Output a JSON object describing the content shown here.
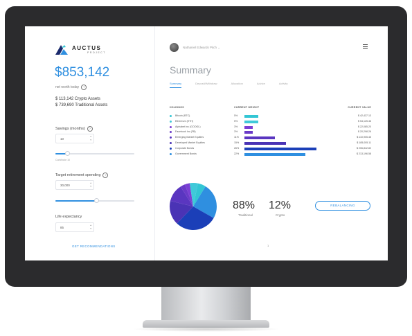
{
  "sidebar": {
    "logo_text": "AUCTUS",
    "logo_sub": "PROJECT",
    "net_worth": "$853,142",
    "net_worth_label": "net worth today",
    "crypto_assets": "$ 113,142 Crypto Assets",
    "traditional_assets": "$ 739,690 Traditional Assets",
    "savings_label": "Savings (months)",
    "savings_value": "10",
    "savings_hint": "Contribute 10",
    "savings_slider": 0.15,
    "target_label": "Target retirement spending",
    "target_value": "30,000",
    "target_slider": 0.52,
    "life_label": "Life expectancy",
    "life_value": "85",
    "get_recommendations": "GET RECOMMENDATIONS"
  },
  "main": {
    "user_name": "Nathaniel Edwards Pitch",
    "title": "Summary",
    "tabs": [
      "Summary",
      "Deposit/Withdraw",
      "Allocation",
      "Advice",
      "Activity"
    ],
    "active_tab": 0,
    "table_headers": {
      "holdings": "HOLDINGS",
      "weight": "CURRENT WEIGHT",
      "value": "CURRENT VALUE"
    },
    "rows": [
      {
        "name": "Bitcoin (BTC)",
        "pct": "5%",
        "weight": 5,
        "color": "#33c6d4",
        "value": "$ 42,437.13"
      },
      {
        "name": "Ethereum (ETH)",
        "pct": "5%",
        "weight": 5,
        "color": "#40c9d9",
        "value": "$ 54,125.46"
      },
      {
        "name": "Alphabet Inc (GOOGL)",
        "pct": "3%",
        "weight": 3,
        "color": "#7b3fd4",
        "value": "$ 22,085.20"
      },
      {
        "name": "Facebook Inc (FB)",
        "pct": "3%",
        "weight": 3,
        "color": "#6a3ac8",
        "value": "$ 20,298.26"
      },
      {
        "name": "Emerging Market Equities",
        "pct": "11%",
        "weight": 11,
        "color": "#5a36c0",
        "value": "$ 110,905.45"
      },
      {
        "name": "Developed Market Equities",
        "pct": "15%",
        "weight": 15,
        "color": "#4a33b5",
        "value": "$ 185,005.11"
      },
      {
        "name": "Corporate Bonds",
        "pct": "26%",
        "weight": 26,
        "color": "#1b3fb8",
        "value": "$ 206,842.82"
      },
      {
        "name": "Government Bonds",
        "pct": "22%",
        "weight": 22,
        "color": "#2f8fe0",
        "value": "$ 213,196.58"
      }
    ],
    "traditional_pct": "88%",
    "traditional_label": "Traditional",
    "crypto_pct": "12%",
    "crypto_label": "Crypto",
    "rebalance_label": "REBALANCING",
    "page_number": "1"
  },
  "icons": {
    "logo": "auctus-logo",
    "help": "question-icon",
    "menu": "hamburger-menu-icon",
    "chevron": "chevron-down-icon"
  },
  "colors": {
    "accent": "#2f8fe0",
    "bezel": "#2b2b2d"
  }
}
